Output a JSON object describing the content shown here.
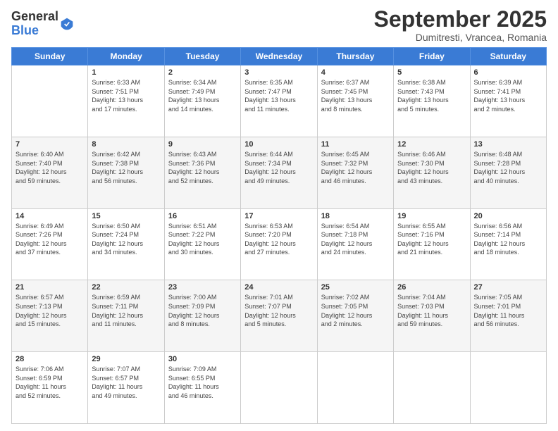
{
  "header": {
    "logo_general": "General",
    "logo_blue": "Blue",
    "month": "September 2025",
    "location": "Dumitresti, Vrancea, Romania"
  },
  "weekdays": [
    "Sunday",
    "Monday",
    "Tuesday",
    "Wednesday",
    "Thursday",
    "Friday",
    "Saturday"
  ],
  "weeks": [
    [
      {
        "day": "",
        "info": ""
      },
      {
        "day": "1",
        "info": "Sunrise: 6:33 AM\nSunset: 7:51 PM\nDaylight: 13 hours\nand 17 minutes."
      },
      {
        "day": "2",
        "info": "Sunrise: 6:34 AM\nSunset: 7:49 PM\nDaylight: 13 hours\nand 14 minutes."
      },
      {
        "day": "3",
        "info": "Sunrise: 6:35 AM\nSunset: 7:47 PM\nDaylight: 13 hours\nand 11 minutes."
      },
      {
        "day": "4",
        "info": "Sunrise: 6:37 AM\nSunset: 7:45 PM\nDaylight: 13 hours\nand 8 minutes."
      },
      {
        "day": "5",
        "info": "Sunrise: 6:38 AM\nSunset: 7:43 PM\nDaylight: 13 hours\nand 5 minutes."
      },
      {
        "day": "6",
        "info": "Sunrise: 6:39 AM\nSunset: 7:41 PM\nDaylight: 13 hours\nand 2 minutes."
      }
    ],
    [
      {
        "day": "7",
        "info": "Sunrise: 6:40 AM\nSunset: 7:40 PM\nDaylight: 12 hours\nand 59 minutes."
      },
      {
        "day": "8",
        "info": "Sunrise: 6:42 AM\nSunset: 7:38 PM\nDaylight: 12 hours\nand 56 minutes."
      },
      {
        "day": "9",
        "info": "Sunrise: 6:43 AM\nSunset: 7:36 PM\nDaylight: 12 hours\nand 52 minutes."
      },
      {
        "day": "10",
        "info": "Sunrise: 6:44 AM\nSunset: 7:34 PM\nDaylight: 12 hours\nand 49 minutes."
      },
      {
        "day": "11",
        "info": "Sunrise: 6:45 AM\nSunset: 7:32 PM\nDaylight: 12 hours\nand 46 minutes."
      },
      {
        "day": "12",
        "info": "Sunrise: 6:46 AM\nSunset: 7:30 PM\nDaylight: 12 hours\nand 43 minutes."
      },
      {
        "day": "13",
        "info": "Sunrise: 6:48 AM\nSunset: 7:28 PM\nDaylight: 12 hours\nand 40 minutes."
      }
    ],
    [
      {
        "day": "14",
        "info": "Sunrise: 6:49 AM\nSunset: 7:26 PM\nDaylight: 12 hours\nand 37 minutes."
      },
      {
        "day": "15",
        "info": "Sunrise: 6:50 AM\nSunset: 7:24 PM\nDaylight: 12 hours\nand 34 minutes."
      },
      {
        "day": "16",
        "info": "Sunrise: 6:51 AM\nSunset: 7:22 PM\nDaylight: 12 hours\nand 30 minutes."
      },
      {
        "day": "17",
        "info": "Sunrise: 6:53 AM\nSunset: 7:20 PM\nDaylight: 12 hours\nand 27 minutes."
      },
      {
        "day": "18",
        "info": "Sunrise: 6:54 AM\nSunset: 7:18 PM\nDaylight: 12 hours\nand 24 minutes."
      },
      {
        "day": "19",
        "info": "Sunrise: 6:55 AM\nSunset: 7:16 PM\nDaylight: 12 hours\nand 21 minutes."
      },
      {
        "day": "20",
        "info": "Sunrise: 6:56 AM\nSunset: 7:14 PM\nDaylight: 12 hours\nand 18 minutes."
      }
    ],
    [
      {
        "day": "21",
        "info": "Sunrise: 6:57 AM\nSunset: 7:13 PM\nDaylight: 12 hours\nand 15 minutes."
      },
      {
        "day": "22",
        "info": "Sunrise: 6:59 AM\nSunset: 7:11 PM\nDaylight: 12 hours\nand 11 minutes."
      },
      {
        "day": "23",
        "info": "Sunrise: 7:00 AM\nSunset: 7:09 PM\nDaylight: 12 hours\nand 8 minutes."
      },
      {
        "day": "24",
        "info": "Sunrise: 7:01 AM\nSunset: 7:07 PM\nDaylight: 12 hours\nand 5 minutes."
      },
      {
        "day": "25",
        "info": "Sunrise: 7:02 AM\nSunset: 7:05 PM\nDaylight: 12 hours\nand 2 minutes."
      },
      {
        "day": "26",
        "info": "Sunrise: 7:04 AM\nSunset: 7:03 PM\nDaylight: 11 hours\nand 59 minutes."
      },
      {
        "day": "27",
        "info": "Sunrise: 7:05 AM\nSunset: 7:01 PM\nDaylight: 11 hours\nand 56 minutes."
      }
    ],
    [
      {
        "day": "28",
        "info": "Sunrise: 7:06 AM\nSunset: 6:59 PM\nDaylight: 11 hours\nand 52 minutes."
      },
      {
        "day": "29",
        "info": "Sunrise: 7:07 AM\nSunset: 6:57 PM\nDaylight: 11 hours\nand 49 minutes."
      },
      {
        "day": "30",
        "info": "Sunrise: 7:09 AM\nSunset: 6:55 PM\nDaylight: 11 hours\nand 46 minutes."
      },
      {
        "day": "",
        "info": ""
      },
      {
        "day": "",
        "info": ""
      },
      {
        "day": "",
        "info": ""
      },
      {
        "day": "",
        "info": ""
      }
    ]
  ],
  "row_classes": [
    "row-light",
    "row-gray",
    "row-light",
    "row-gray",
    "row-light"
  ]
}
